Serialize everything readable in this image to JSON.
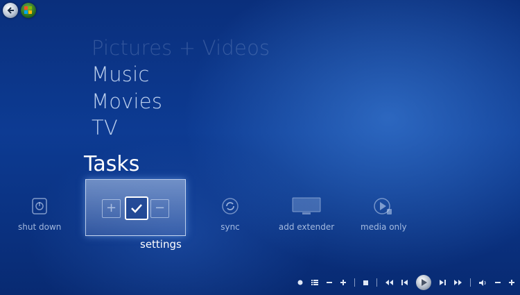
{
  "menu": {
    "items": [
      "Pictures + Videos",
      "Music",
      "Movies",
      "TV"
    ],
    "section_title": "Tasks"
  },
  "tasks": {
    "items": [
      {
        "label": "shut down",
        "icon": "power-icon"
      },
      {
        "label": "settings",
        "icon": "checkmark-icon"
      },
      {
        "label": "sync",
        "icon": "sync-icon"
      },
      {
        "label": "add extender",
        "icon": "monitor-icon"
      },
      {
        "label": "media only",
        "icon": "media-only-icon"
      }
    ],
    "selected": "settings"
  },
  "transport": {
    "controls": [
      "record",
      "guide",
      "channel-down",
      "channel-up",
      "stop",
      "rewind",
      "previous",
      "play",
      "next",
      "fast-forward",
      "mute",
      "volume-down",
      "volume-up"
    ],
    "symbols": {
      "minus": "−",
      "plus": "+"
    }
  },
  "colors": {
    "background": "#0d3b93",
    "panel_border": "#e6f0ff",
    "text": "#ffffff"
  }
}
